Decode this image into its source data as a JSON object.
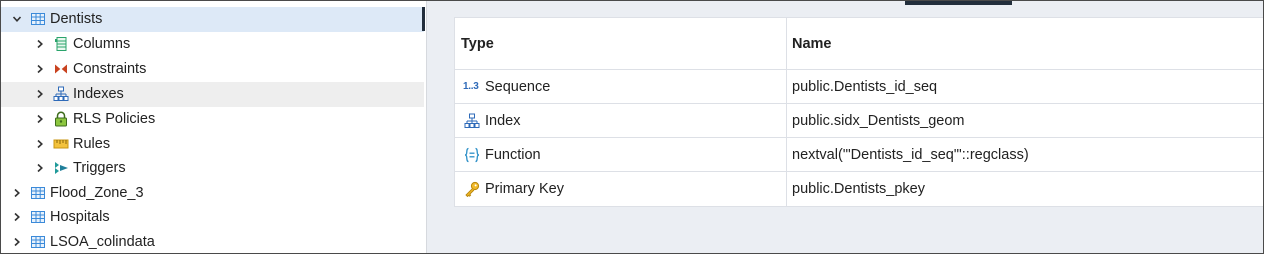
{
  "tree": {
    "items": [
      {
        "label": "Dentists",
        "icon": "table-icon",
        "level": 0,
        "expanded": true,
        "selected": true
      },
      {
        "label": "Columns",
        "icon": "columns-icon",
        "level": 1,
        "expanded": false
      },
      {
        "label": "Constraints",
        "icon": "constraints-icon",
        "level": 1,
        "expanded": false
      },
      {
        "label": "Indexes",
        "icon": "index-icon",
        "level": 1,
        "expanded": false,
        "hover": true
      },
      {
        "label": "RLS Policies",
        "icon": "lock-icon",
        "level": 1,
        "expanded": false
      },
      {
        "label": "Rules",
        "icon": "rules-icon",
        "level": 1,
        "expanded": false
      },
      {
        "label": "Triggers",
        "icon": "trigger-icon",
        "level": 1,
        "expanded": false
      },
      {
        "label": "Flood_Zone_3",
        "icon": "table-icon",
        "level": 0,
        "expanded": false
      },
      {
        "label": "Hospitals",
        "icon": "table-icon",
        "level": 0,
        "expanded": false
      },
      {
        "label": "LSOA_colindata",
        "icon": "table-icon",
        "level": 0,
        "expanded": false
      }
    ]
  },
  "grid": {
    "headers": {
      "type": "Type",
      "name": "Name"
    },
    "rows": [
      {
        "type": "Sequence",
        "name": "public.Dentists_id_seq",
        "icon": "sequence-icon",
        "glyph": "1..3"
      },
      {
        "type": "Index",
        "name": "public.sidx_Dentists_geom",
        "icon": "index-icon"
      },
      {
        "type": "Function",
        "name": "nextval('\"Dentists_id_seq\"'::regclass)",
        "icon": "function-icon"
      },
      {
        "type": "Primary Key",
        "name": "public.Dentists_pkey",
        "icon": "key-icon"
      }
    ]
  },
  "colors": {
    "selected_row": "#dde9f7",
    "hover_row": "#eeeeee",
    "panel_bg": "#ebeef3",
    "accent_dark": "#222e3c",
    "table_icon": "#3b8ad9"
  }
}
